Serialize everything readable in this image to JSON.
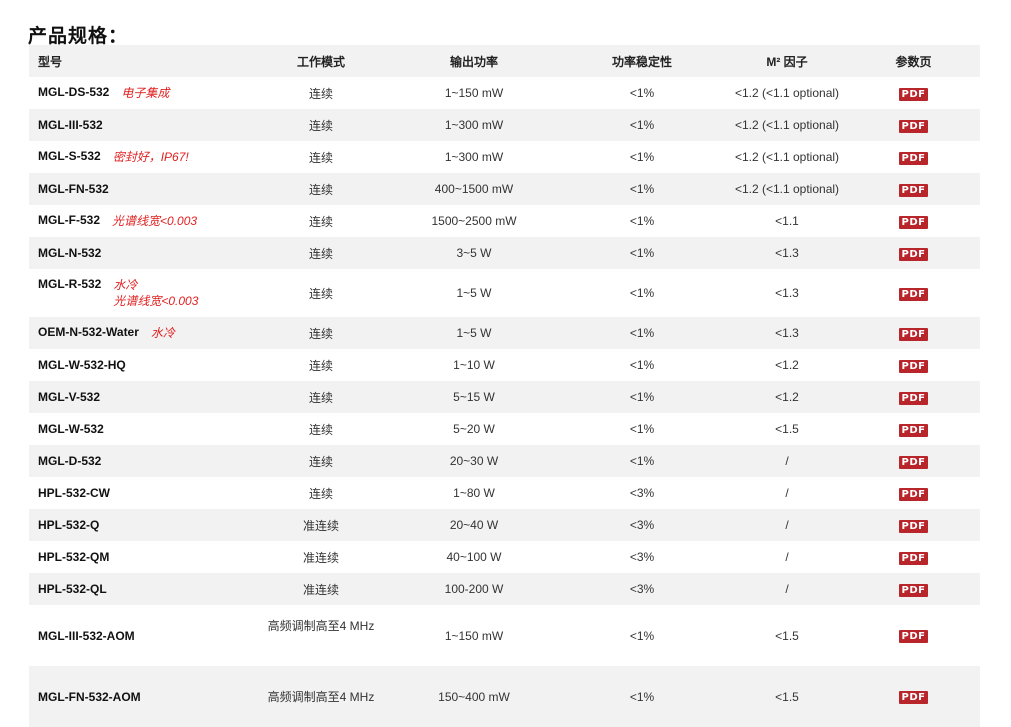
{
  "title": "产品规格：",
  "headers": {
    "model": "型号",
    "mode": "工作模式",
    "power": "输出功率",
    "stability": "功率稳定性",
    "m2": "M² 因子",
    "datasheet": "参数页"
  },
  "pdf_label": "PDF",
  "rows": [
    {
      "model": "MGL-DS-532",
      "note": "电子集成",
      "mode": "连续",
      "power": "1~150 mW",
      "stability": "<1%",
      "m2": "<1.2 (<1.1 optional)"
    },
    {
      "model": "MGL-III-532",
      "note": "",
      "mode": "连续",
      "power": "1~300 mW",
      "stability": "<1%",
      "m2": "<1.2 (<1.1 optional)"
    },
    {
      "model": "MGL-S-532",
      "note": "密封好，IP67!",
      "mode": "连续",
      "power": "1~300 mW",
      "stability": "<1%",
      "m2": "<1.2 (<1.1 optional)"
    },
    {
      "model": "MGL-FN-532",
      "note": "",
      "mode": "连续",
      "power": "400~1500 mW",
      "stability": "<1%",
      "m2": "<1.2 (<1.1 optional)"
    },
    {
      "model": "MGL-F-532",
      "note": "光谱线宽<0.003",
      "mode": "连续",
      "power": "1500~2500 mW",
      "stability": "<1%",
      "m2": "<1.1"
    },
    {
      "model": "MGL-N-532",
      "note": "",
      "mode": "连续",
      "power": "3~5 W",
      "stability": "<1%",
      "m2": "<1.3"
    },
    {
      "model": "MGL-R-532",
      "note": "水冷",
      "note2": "光谱线宽<0.003",
      "mode": "连续",
      "power": "1~5 W",
      "stability": "<1%",
      "m2": "<1.3"
    },
    {
      "model": "OEM-N-532-Water",
      "note": "水冷",
      "mode": "连续",
      "power": "1~5 W",
      "stability": "<1%",
      "m2": "<1.3"
    },
    {
      "model": "MGL-W-532-HQ",
      "note": "",
      "mode": "连续",
      "power": "1~10 W",
      "stability": "<1%",
      "m2": "<1.2"
    },
    {
      "model": "MGL-V-532",
      "note": "",
      "mode": "连续",
      "power": "5~15 W",
      "stability": "<1%",
      "m2": "<1.2"
    },
    {
      "model": "MGL-W-532",
      "note": "",
      "mode": "连续",
      "power": "5~20 W",
      "stability": "<1%",
      "m2": "<1.5"
    },
    {
      "model": "MGL-D-532",
      "note": "",
      "mode": "连续",
      "power": "20~30 W",
      "stability": "<1%",
      "m2": "/"
    },
    {
      "model": "HPL-532-CW",
      "note": "",
      "mode": "连续",
      "power": "1~80 W",
      "stability": "<3%",
      "m2": "/"
    },
    {
      "model": "HPL-532-Q",
      "note": "",
      "mode": "准连续",
      "power": "20~40 W",
      "stability": "<3%",
      "m2": "/"
    },
    {
      "model": "HPL-532-QM",
      "note": "",
      "mode": "准连续",
      "power": "40~100 W",
      "stability": "<3%",
      "m2": "/"
    },
    {
      "model": "HPL-532-QL",
      "note": "",
      "mode": "准连续",
      "power": "100-200 W",
      "stability": "<3%",
      "m2": "/"
    },
    {
      "model": "MGL-III-532-AOM",
      "note": "",
      "mode": "高频调制高至4 MHz",
      "power": "1~150 mW",
      "stability": "<1%",
      "m2": "<1.5"
    },
    {
      "model": "MGL-FN-532-AOM",
      "note": "",
      "mode": "高频调制高至4 MHz",
      "power": "150~400 mW",
      "stability": "<1%",
      "m2": "<1.5"
    }
  ]
}
